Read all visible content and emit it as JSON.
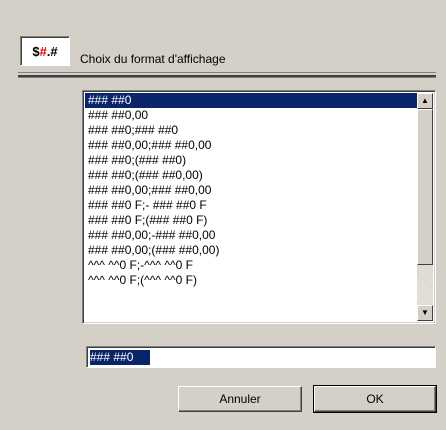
{
  "icon": {
    "dollar": "$",
    "hash1": "#",
    "dot": ".",
    "hash2": "#"
  },
  "dialog": {
    "title": "Choix du format d'affichage"
  },
  "formats": [
    "### ##0",
    "### ##0,00",
    "### ##0;### ##0",
    "### ##0,00;### ##0,00",
    "### ##0;(### ##0)",
    "### ##0;(### ##0,00)",
    "### ##0,00;### ##0,00",
    "### ##0 F;- ### ##0 F",
    "### ##0 F;(### ##0 F)",
    "### ##0,00;-### ##0,00",
    "### ##0,00;(### ##0,00)",
    " ^^^ ^^0 F;-^^^ ^^0 F",
    "^^^ ^^0 F;(^^^ ^^0 F)"
  ],
  "selected_index": 0,
  "format_input": {
    "value": "### ##0"
  },
  "buttons": {
    "cancel": "Annuler",
    "ok": "OK"
  },
  "colors": {
    "selection": "#0a246a",
    "icon_red": "#e00000",
    "face": "#d4d0c8"
  }
}
